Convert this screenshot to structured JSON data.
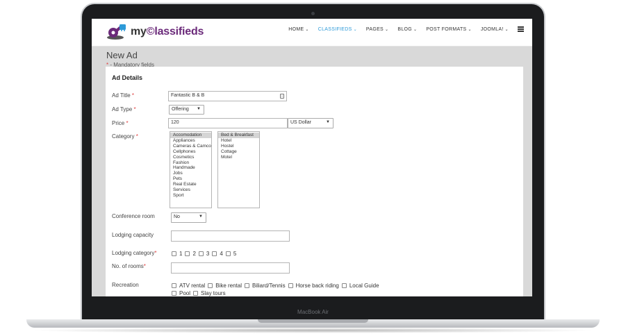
{
  "device": {
    "label": "MacBook Air"
  },
  "header": {
    "logo": {
      "prefix": "my",
      "accent": "©lassifieds"
    },
    "nav": [
      {
        "label": "HOME",
        "active": false
      },
      {
        "label": "CLASSIFIEDS",
        "active": true
      },
      {
        "label": "PAGES",
        "active": false
      },
      {
        "label": "BLOG",
        "active": false
      },
      {
        "label": "POST FORMATS",
        "active": false
      },
      {
        "label": "JOOMLA!",
        "active": false
      }
    ]
  },
  "page": {
    "title": "New Ad",
    "mandatory_star": "*",
    "mandatory_text": "-  Mandatory fields",
    "section_title": "Ad Details"
  },
  "form": {
    "ad_title": {
      "label": "Ad Title",
      "value": "Fantastic B & B"
    },
    "ad_type": {
      "label": "Ad Type",
      "value": "Offering"
    },
    "price": {
      "label": "Price",
      "value": "120",
      "currency": "US Dollar"
    },
    "category": {
      "label": "Category",
      "main_options": [
        "Accomodation",
        "Appliances",
        "Cameras & Camcor",
        "Cellphones",
        "Cosmetics",
        "Fashion",
        "Handmade",
        "Jobs",
        "Pets",
        "Real Estate",
        "Services",
        "Sport"
      ],
      "main_selected": "Accomodation",
      "sub_options": [
        "Bed & Breakfast",
        "Hotel",
        "Hostel",
        "Cottage",
        "Motel"
      ],
      "sub_selected": "Bed & Breakfast"
    },
    "conference_room": {
      "label": "Conference room",
      "value": "No"
    },
    "lodging_capacity": {
      "label": "Lodging capacity",
      "value": ""
    },
    "lodging_category": {
      "label": "Lodging category",
      "options": [
        "1",
        "2",
        "3",
        "4",
        "5"
      ]
    },
    "num_rooms": {
      "label": "No. of rooms",
      "value": ""
    },
    "recreation": {
      "label": "Recreation",
      "options": [
        "ATV rental",
        "Bike rental",
        "Biliard/Tennis",
        "Horse back riding",
        "Local Guide",
        "Pool",
        "Slay tours"
      ]
    },
    "required_star": "*"
  }
}
